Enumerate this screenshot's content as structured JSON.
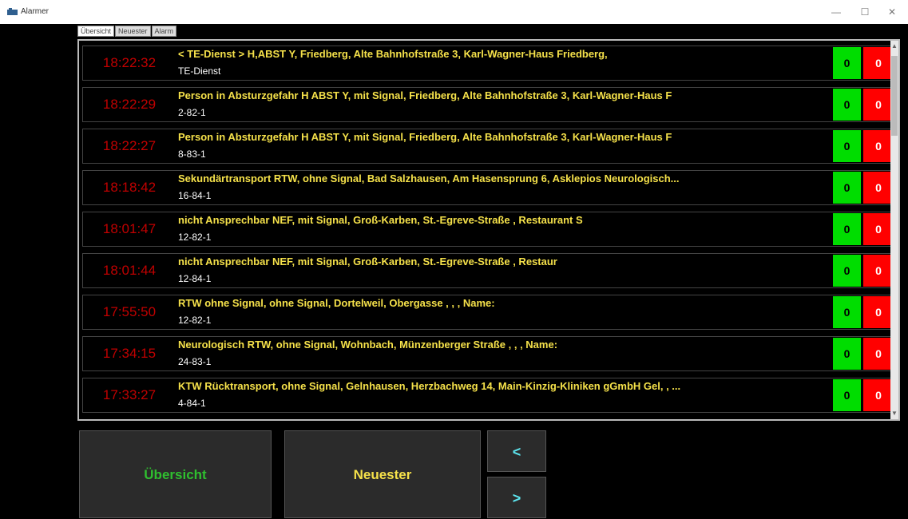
{
  "window": {
    "title": "Alarmer"
  },
  "tabs": [
    "Übersicht",
    "Neuester",
    "Alarm"
  ],
  "colors": {
    "time": "#c00000",
    "title": "#f5e14a",
    "green": "#00dd00",
    "red": "#ff0000"
  },
  "rows": [
    {
      "time": "18:22:32",
      "title": "< TE-Dienst > H,ABST Y, Friedberg, Alte Bahnhofstraße 3, Karl-Wagner-Haus Friedberg,",
      "sub": "TE-Dienst",
      "green": "0",
      "red": "0"
    },
    {
      "time": "18:22:29",
      "title": "Person in Absturzgefahr H ABST Y, mit Signal, Friedberg, Alte Bahnhofstraße 3, Karl-Wagner-Haus F",
      "sub": "2-82-1",
      "green": "0",
      "red": "0"
    },
    {
      "time": "18:22:27",
      "title": "Person in Absturzgefahr H ABST Y, mit Signal, Friedberg, Alte Bahnhofstraße 3, Karl-Wagner-Haus F",
      "sub": "8-83-1",
      "green": "0",
      "red": "0"
    },
    {
      "time": "18:18:42",
      "title": "Sekundärtransport RTW, ohne Signal, Bad Salzhausen, Am Hasensprung 6, Asklepios Neurologisch...",
      "sub": "16-84-1",
      "green": "0",
      "red": "0"
    },
    {
      "time": "18:01:47",
      "title": "nicht Ansprechbar NEF, mit Signal, Groß-Karben, St.-Egreve-Straße    , Restaurant S",
      "sub": "12-82-1",
      "green": "0",
      "red": "0"
    },
    {
      "time": "18:01:44",
      "title": "nicht Ansprechbar NEF, mit Signal, Groß-Karben, St.-Egreve-Straße    , Restaur",
      "sub": "12-84-1",
      "green": "0",
      "red": "0"
    },
    {
      "time": "17:55:50",
      "title": "RTW ohne Signal, ohne Signal, Dortelweil, Obergasse     , , , Name:",
      "sub": "12-82-1",
      "green": "0",
      "red": "0"
    },
    {
      "time": "17:34:15",
      "title": "Neurologisch RTW, ohne Signal, Wohnbach, Münzenberger Straße    , , , Name:",
      "sub": "24-83-1",
      "green": "0",
      "red": "0"
    },
    {
      "time": "17:33:27",
      "title": "KTW Rücktransport, ohne Signal, Gelnhausen, Herzbachweg 14, Main-Kinzig-Kliniken gGmbH Gel, , ...",
      "sub": "4-84-1",
      "green": "0",
      "red": "0"
    }
  ],
  "buttons": {
    "overview": "Übersicht",
    "newest": "Neuester",
    "prev": "<",
    "next": ">"
  }
}
